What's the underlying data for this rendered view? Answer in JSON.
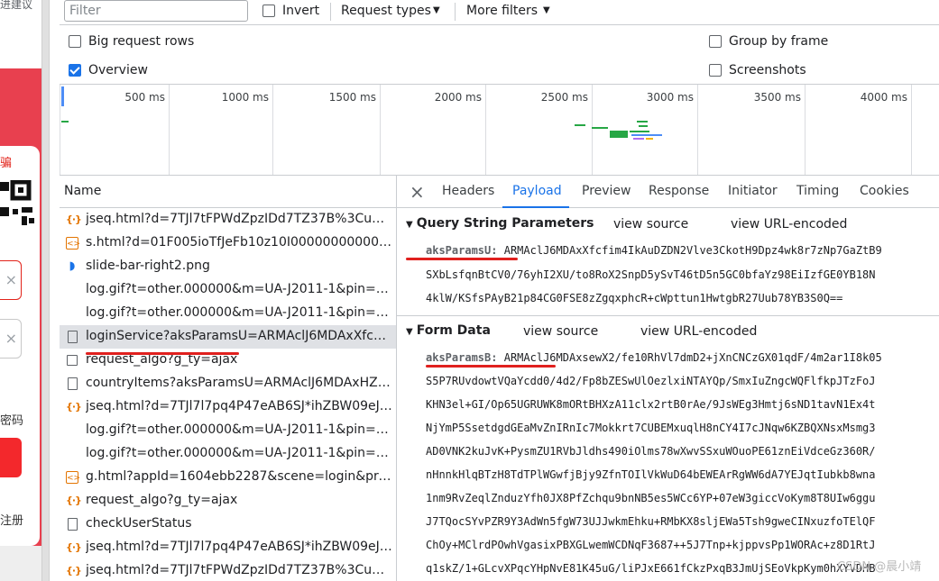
{
  "page": {
    "top_text": "进建议",
    "red_text": "骗",
    "password_text": "密码",
    "register_text": "注册",
    "input_clear_icon": "×"
  },
  "toolbar": {
    "filter_placeholder": "Filter",
    "invert_label": "Invert",
    "request_types_label": "Request types",
    "more_filters_label": "More filters",
    "big_request_rows_label": "Big request rows",
    "overview_label": "Overview",
    "group_by_frame_label": "Group by frame",
    "screenshots_label": "Screenshots",
    "overview_checked": true
  },
  "overview": {
    "ticks": [
      "500 ms",
      "1000 ms",
      "1500 ms",
      "2000 ms",
      "2500 ms",
      "3000 ms",
      "3500 ms",
      "4000 ms"
    ]
  },
  "request_list": {
    "header": "Name",
    "rows": [
      {
        "type": "xhr",
        "name": "jseq.html?d=7TJl7tFPWdZpzIDd7TZ37B%3CuwIW..."
      },
      {
        "type": "script",
        "name": "s.html?d=01F005ioTfJeFb10z10I000000000001G..."
      },
      {
        "type": "img",
        "name": "slide-bar-right2.png"
      },
      {
        "type": "none",
        "name": "log.gif?t=other.000000&m=UA-J2011-1&pin=-&..."
      },
      {
        "type": "none",
        "name": "log.gif?t=other.000000&m=UA-J2011-1&pin=-&..."
      },
      {
        "type": "doc",
        "name": "loginService?aksParamsU=ARMAclJ6MDAxXfcfim...",
        "selected": true
      },
      {
        "type": "check",
        "name": "request_algo?g_ty=ajax"
      },
      {
        "type": "doc",
        "name": "countryItems?aksParamsU=ARMAclJ6MDAxHZLX..."
      },
      {
        "type": "xhr",
        "name": "jseq.html?d=7TJl7l7pq4P47eAB6SJ*ihZBW09eJN9..."
      },
      {
        "type": "none",
        "name": "log.gif?t=other.000000&m=UA-J2011-1&pin=-&..."
      },
      {
        "type": "none",
        "name": "log.gif?t=other.000000&m=UA-J2011-1&pin=-&..."
      },
      {
        "type": "script",
        "name": "g.html?appId=1604ebb2287&scene=login&prod..."
      },
      {
        "type": "xhr",
        "name": "request_algo?g_ty=ajax"
      },
      {
        "type": "doc",
        "name": "checkUserStatus"
      },
      {
        "type": "xhr",
        "name": "jseq.html?d=7TJl7l7pq4P47eAB6SJ*ihZBW09eJN9..."
      },
      {
        "type": "xhr",
        "name": "jseq.html?d=7TJl7tFPWdZpzIDd7TZ37B%3CuwIW..."
      }
    ]
  },
  "tabs": {
    "close_icon": "×",
    "items": [
      "Headers",
      "Payload",
      "Preview",
      "Response",
      "Initiator",
      "Timing",
      "Cookies"
    ],
    "active": "Payload"
  },
  "payload": {
    "query_title": "Query String Parameters",
    "view_source": "view source",
    "view_url_encoded": "view URL-encoded",
    "query_key": "aksParamsU:",
    "query_lines": [
      "ARMAclJ6MDAxXfcfim4IkAuDZDN2Vlve3CkotH9Dpz4wk8r7zNp7GaZtB9",
      "SXbLsfqnBtCV0/76yhI2XU/to8RoX2SnpD5ySvT46tD5n5GC0bfaYz98EiIzfGE0YB18N",
      "4klW/KSfsPAyB21p84CG0FSE8zZgqxphcR+cWpttun1HwtgbR27Uub78YB3S0Q=="
    ],
    "form_title": "Form Data",
    "form_key": "aksParamsB:",
    "form_lines": [
      "ARMAclJ6MDAxsewX2/fe10RhVl7dmD2+jXnCNCzGX01qdF/4m2ar1I8k05",
      "S5P7RUvdowtVQaYcdd0/4d2/Fp8bZESwUlOezlxiNTAYQp/SmxIuZngcWQFlfkpJTzFoJ",
      "KHN3el+GI/Op65UGRUWK8mORtBHXzA11clx2rtB0rAe/9JsWEg3Hmtj6sND1tavN1Ex4t",
      "NjYmP5SsetdgdGEaMvZnIRnIc7Mokkrt7CUBEMxuqlH8nCY4I7cJNqw6KZBQXNsxMsmg3",
      "AD0VNK2kuJvK+PysmZU1RVbJldhs490iOlms78wXwvSSxuWOuoPE61znEiVdceGz360R/",
      "nHnnkHlqBTzH8TdTPlWGwfjBjy9ZfnTOIlVkWuD64bEWEArRgWW6dA7YEJqtIubkb8wna",
      "1nm9RvZeqlZnduzYfh0JX8PfZchqu9bnNB5es5WCc6YP+07eW3giccVoKym8T8UIw6ggu",
      "J7TQocSYvPZR9Y3AdWn5fgW73UJJwkmEhku+RMbKX8sljEWa5Tsh9gweCINxuzfoTElQF",
      "ChOy+MClrdPOwhVgasixPBXGLwemWCDNqF3687++5J7Tnp+kjppvsPp1WORAc+z8D1RtJ",
      "q1skZ/1+GLcvXPqcYHpNvE81K45uG/liPJxE661fCkzPxqB3JmUjSEoVkpKym0hXYVDHB"
    ]
  },
  "watermark": "CSDN @晨小靖",
  "colors": {
    "accent": "#1a73e8",
    "annotation_red": "#e0201e",
    "page_pink": "#e8404f"
  }
}
